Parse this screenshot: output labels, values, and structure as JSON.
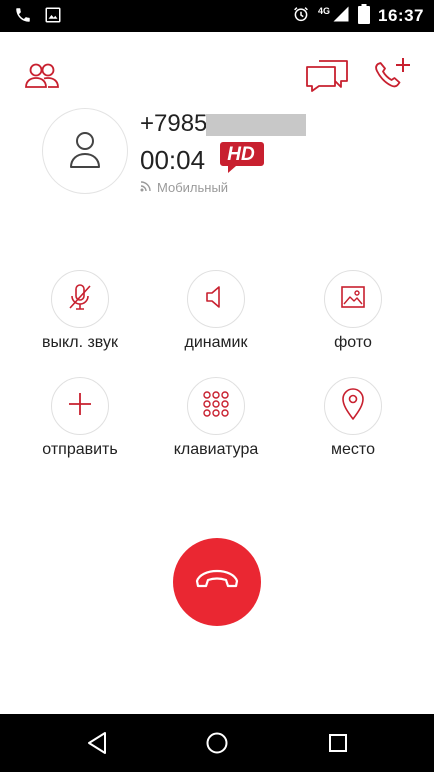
{
  "status_bar": {
    "network": "4G",
    "time": "16:37"
  },
  "contact": {
    "phone_number": "+7985",
    "call_duration": "00:04",
    "hd_label": "HD",
    "network_type": "Мобильный"
  },
  "actions": [
    {
      "label": "выкл. звук",
      "icon": "mic-off-icon"
    },
    {
      "label": "динамик",
      "icon": "speaker-icon"
    },
    {
      "label": "фото",
      "icon": "photo-icon"
    },
    {
      "label": "отправить",
      "icon": "plus-icon"
    },
    {
      "label": "клавиатура",
      "icon": "keypad-icon"
    },
    {
      "label": "место",
      "icon": "location-pin-icon"
    }
  ],
  "colors": {
    "accent": "#c8202f",
    "end_call": "#ea2732",
    "icon_gray": "#555555"
  }
}
